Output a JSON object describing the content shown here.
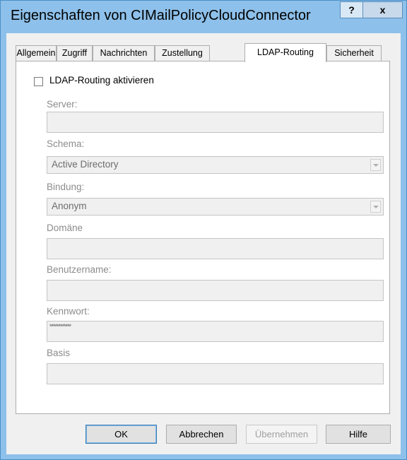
{
  "window": {
    "title": "Eigenschaften von CIMailPolicyCloudConnector",
    "help_glyph": "?",
    "close_glyph": "x"
  },
  "tabs": [
    {
      "label": "Allgemein",
      "active": false
    },
    {
      "label": "Zugriff",
      "active": false
    },
    {
      "label": "Nachrichten",
      "active": false
    },
    {
      "label": "Zustellung",
      "active": false
    },
    {
      "label": "LDAP-Routing",
      "active": true
    },
    {
      "label": "Sicherheit",
      "active": false
    }
  ],
  "ldap": {
    "enable_label": "LDAP-Routing aktivieren",
    "enable_checked": false,
    "server_label": "Server:",
    "server_value": "",
    "schema_label": "Schema:",
    "schema_value": "Active Directory",
    "binding_label": "Bindung:",
    "binding_value": "Anonym",
    "domain_label": "Domäne",
    "domain_value": "",
    "username_label": "Benutzername:",
    "username_value": "",
    "password_label": "Kennwort:",
    "password_value": "************",
    "base_label": "Basis",
    "base_value": ""
  },
  "buttons": {
    "ok": "OK",
    "cancel": "Abbrechen",
    "apply": "Übernehmen",
    "help": "Hilfe"
  },
  "colors": {
    "titlebar": "#8dc0ea",
    "disabled_text": "#8c8c8c"
  }
}
